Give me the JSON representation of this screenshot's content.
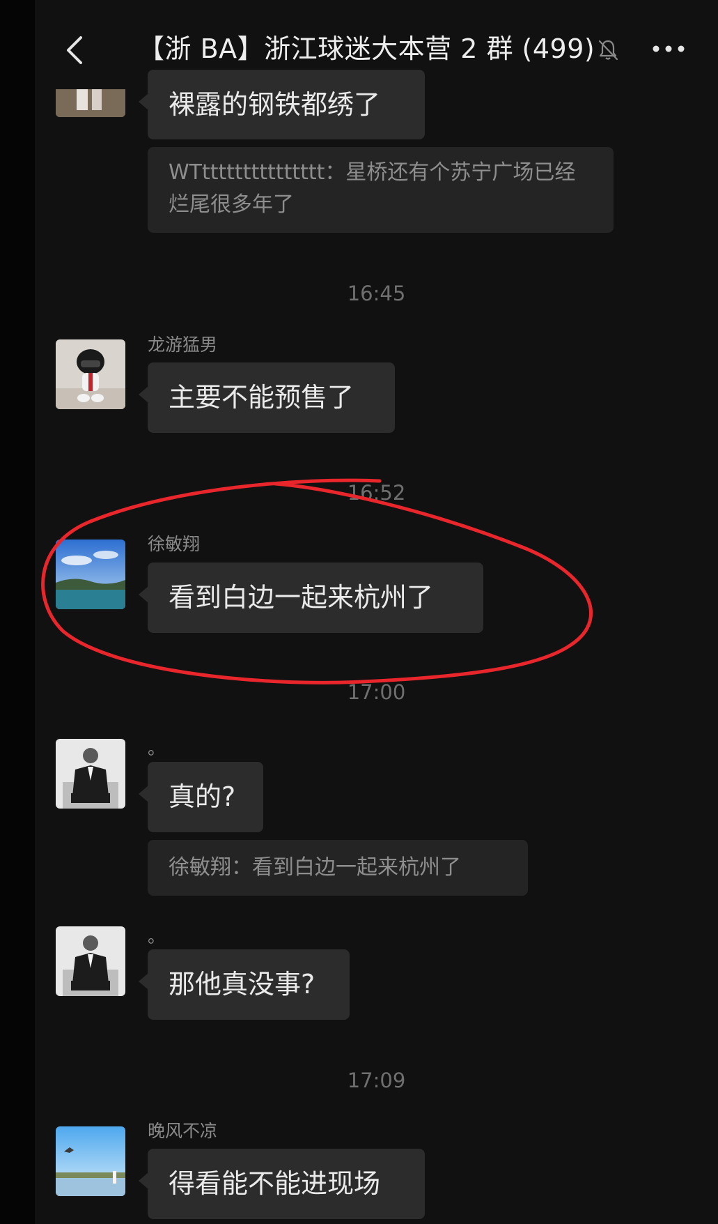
{
  "header": {
    "title": "【浙 BA】浙江球迷大本营 2 群 (499)",
    "back_icon": "chevron-left-icon",
    "mute_icon": "bell-muted-icon",
    "more_icon": "ellipsis-icon"
  },
  "messages": [
    {
      "sender": "",
      "text": "裸露的钢铁都绣了"
    },
    {
      "quote": "WTttttttttttttttt：星桥还有个苏宁广场已经烂尾很多年了"
    },
    {
      "time": "16:45"
    },
    {
      "sender": "龙游猛男",
      "text": "主要不能预售了"
    },
    {
      "time": "16:52"
    },
    {
      "sender": "徐敏翔",
      "text": "看到白边一起来杭州了"
    },
    {
      "time": "17:00"
    },
    {
      "sender": "。",
      "text": "真的?"
    },
    {
      "quote": "徐敏翔：看到白边一起来杭州了"
    },
    {
      "sender": "。",
      "text": "那他真没事?"
    },
    {
      "time": "17:09"
    },
    {
      "sender": "晚风不凉",
      "text": "得看能不能进现场"
    }
  ],
  "annotation": {
    "color": "#e8262b"
  },
  "colors": {
    "background": "#111111",
    "bubble": "#2c2c2c",
    "quote": "#242424",
    "text": "#eaeaea",
    "muted": "#8a8a8a"
  }
}
